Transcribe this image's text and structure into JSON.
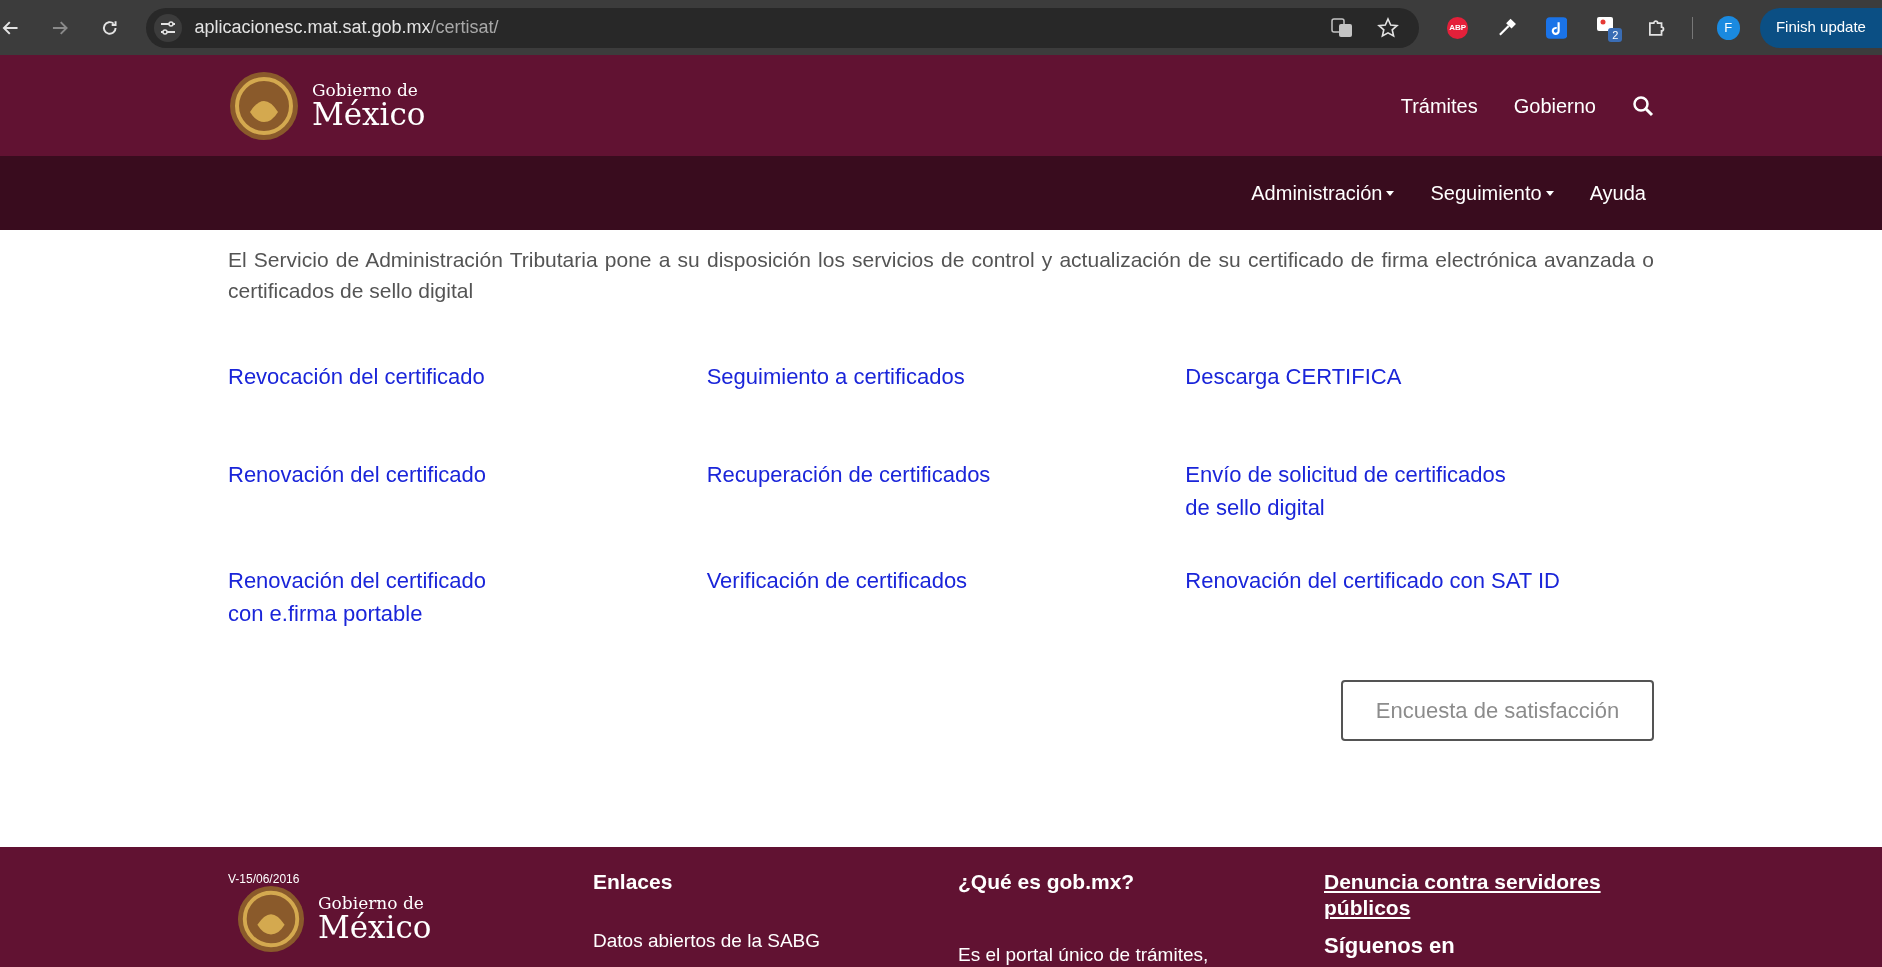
{
  "browser": {
    "url_host": "aplicacionesc.mat.sat.gob.mx",
    "url_path": "/certisat/",
    "forward_disabled": true,
    "extension_badge": "2",
    "abp_label": "ABP",
    "avatar": "F",
    "update_button": "Finish update"
  },
  "header": {
    "logo_line1": "Gobierno de",
    "logo_line2": "México",
    "nav": [
      "Trámites",
      "Gobierno"
    ]
  },
  "subnav": [
    {
      "label": "Administración",
      "dropdown": true
    },
    {
      "label": "Seguimiento",
      "dropdown": true
    },
    {
      "label": "Ayuda",
      "dropdown": false
    }
  ],
  "intro": "El Servicio de Administración Tributaria pone a su disposición los servicios de control y actualización de su certificado de firma electrónica avanzada o certificados de sello digital",
  "links": [
    {
      "lines": [
        "Revocación del certificado"
      ]
    },
    {
      "lines": [
        "Seguimiento a certificados"
      ]
    },
    {
      "lines": [
        "Descarga CERTIFICA"
      ]
    },
    {
      "lines": [
        "Renovación del certificado"
      ]
    },
    {
      "lines": [
        "Recuperación de certificados"
      ]
    },
    {
      "lines": [
        "Envío de solicitud de certificados",
        "de sello digital"
      ]
    },
    {
      "lines": [
        "Renovación del certificado",
        "con e.firma portable"
      ]
    },
    {
      "lines": [
        "Verificación de certificados"
      ]
    },
    {
      "lines": [
        "Renovación del certificado con SAT ID"
      ]
    }
  ],
  "survey_button": "Encuesta de satisfacción",
  "footer": {
    "version": "V-15/06/2016",
    "logo_line1": "Gobierno de",
    "logo_line2": "México",
    "columns": [
      {
        "heading": "Enlaces",
        "underlined": false,
        "items": [
          {
            "text": "Datos abiertos de la SABG",
            "kind": "text"
          }
        ]
      },
      {
        "heading": "¿Qué es gob.mx?",
        "underlined": false,
        "items": [
          {
            "text": "Es el portal único de trámites,",
            "kind": "text"
          }
        ]
      },
      {
        "heading": "Denuncia contra servidores públicos",
        "underlined": true,
        "items": [
          {
            "text": "Síguenos en",
            "kind": "heading"
          }
        ]
      }
    ]
  }
}
